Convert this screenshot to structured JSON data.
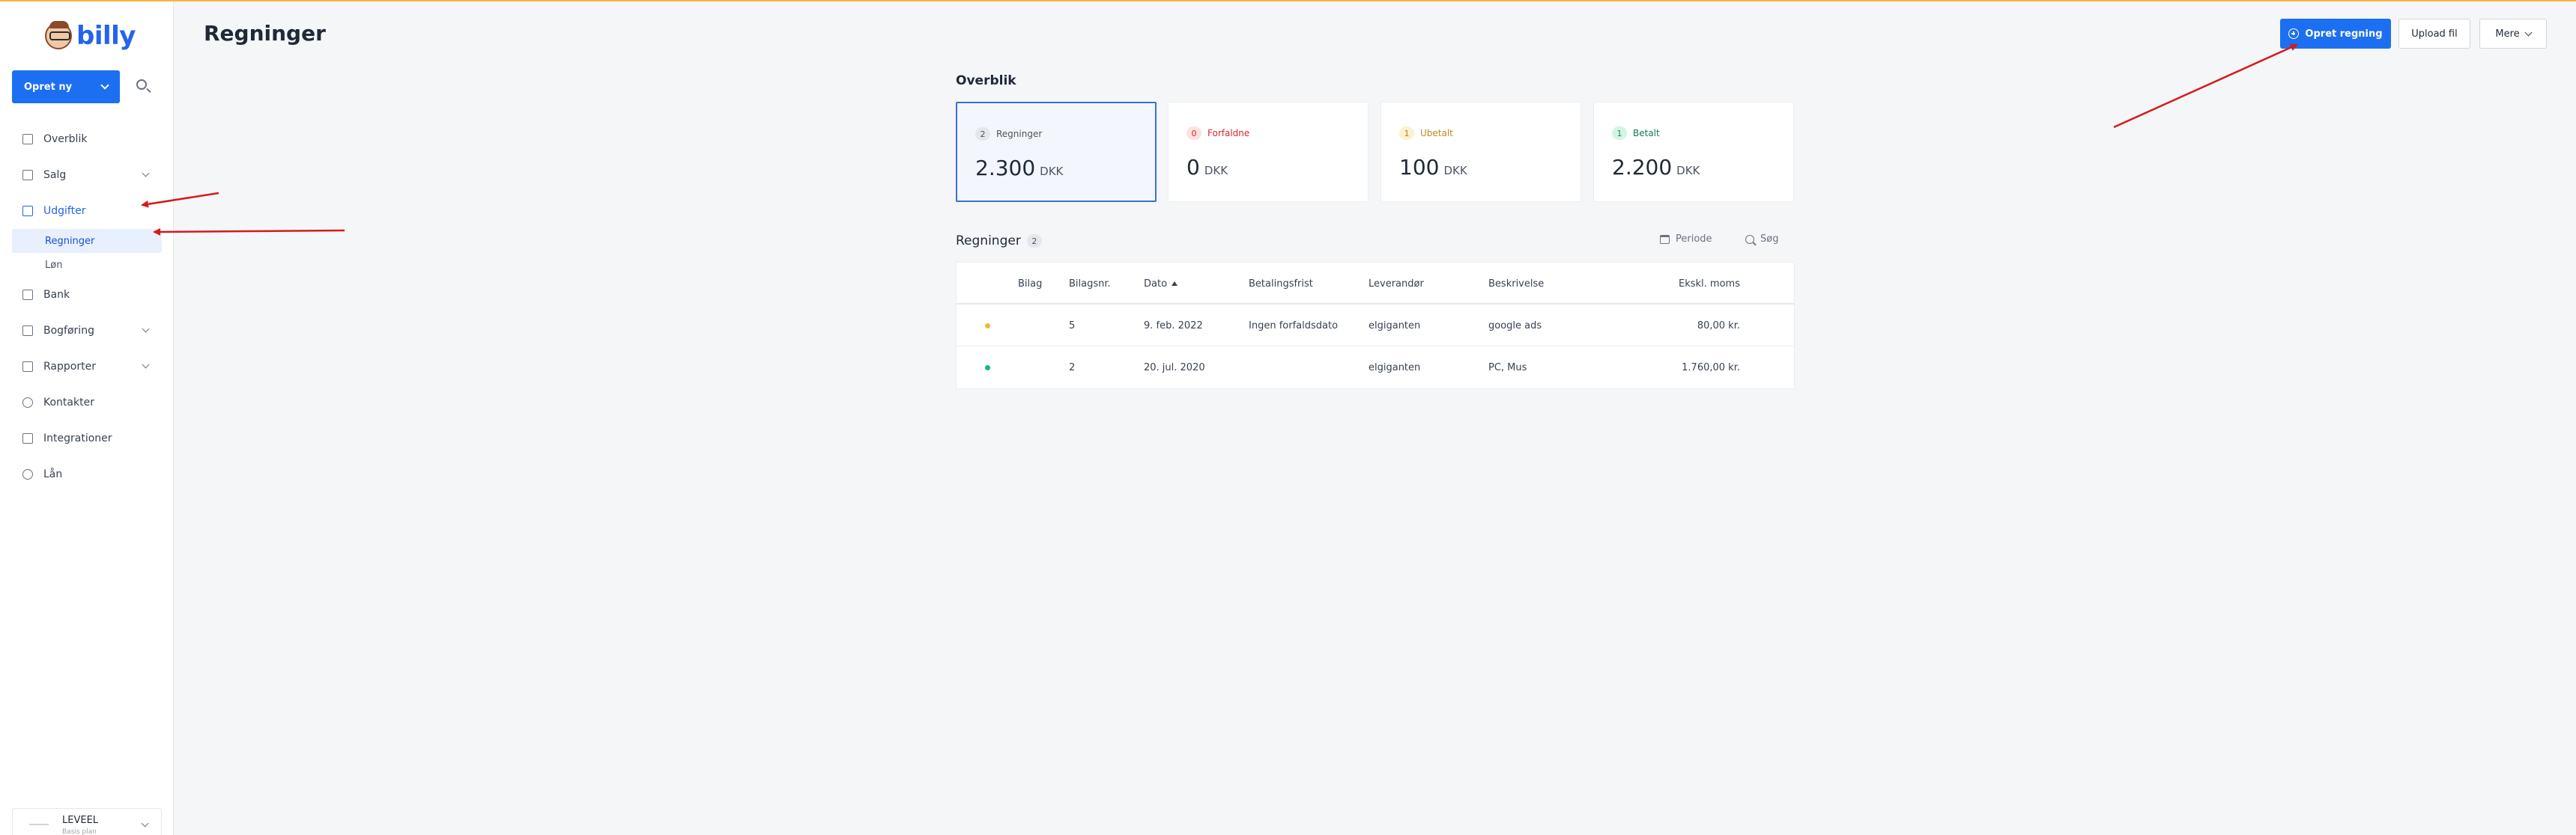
{
  "app": {
    "name": "billy"
  },
  "sidebar": {
    "create_label": "Opret ny",
    "items": [
      {
        "label": "Overblik",
        "icon": "monitor-icon"
      },
      {
        "label": "Salg",
        "icon": "shop-icon"
      },
      {
        "label": "Udgifter",
        "icon": "receipt-icon"
      },
      {
        "label": "Bank",
        "icon": "bank-icon"
      },
      {
        "label": "Bogføring",
        "icon": "ledger-icon"
      },
      {
        "label": "Rapporter",
        "icon": "report-icon"
      },
      {
        "label": "Kontakter",
        "icon": "contacts-icon"
      },
      {
        "label": "Integrationer",
        "icon": "integration-icon"
      },
      {
        "label": "Lån",
        "icon": "loan-icon"
      }
    ],
    "subitems": [
      {
        "label": "Regninger"
      },
      {
        "label": "Løn"
      }
    ],
    "company": {
      "name": "LEVEEL",
      "sub": "Basis plan"
    }
  },
  "header": {
    "title": "Regninger",
    "create_bill": "Opret regning",
    "upload": "Upload fil",
    "more": "Mere"
  },
  "overview": {
    "title": "Overblik",
    "cards": [
      {
        "count": "2",
        "label": "Regninger",
        "amount": "2.300",
        "currency": "DKK"
      },
      {
        "count": "0",
        "label": "Forfaldne",
        "amount": "0",
        "currency": "DKK"
      },
      {
        "count": "1",
        "label": "Ubetalt",
        "amount": "100",
        "currency": "DKK"
      },
      {
        "count": "1",
        "label": "Betalt",
        "amount": "2.200",
        "currency": "DKK"
      }
    ]
  },
  "bills": {
    "title": "Regninger",
    "count": "2",
    "period": "Periode",
    "search": "Søg",
    "columns": [
      "Bilag",
      "Bilagsnr.",
      "Dato",
      "Betalingsfrist",
      "Leverandør",
      "Beskrivelse",
      "Ekskl. moms"
    ],
    "rows": [
      {
        "status_color": "#f2b544",
        "bilagsnr": "5",
        "dato": "9. feb. 2022",
        "frist": "Ingen forfaldsdato",
        "leverandor": "elgiganten",
        "beskrivelse": "google ads",
        "belob": "80,00 kr."
      },
      {
        "status_color": "#10b981",
        "bilagsnr": "2",
        "dato": "20. jul. 2020",
        "frist": "",
        "leverandor": "elgiganten",
        "beskrivelse": "PC, Mus",
        "belob": "1.760,00 kr."
      }
    ]
  },
  "colors": {
    "primary": "#1d6ff2",
    "annotation": "#d61a1a"
  }
}
